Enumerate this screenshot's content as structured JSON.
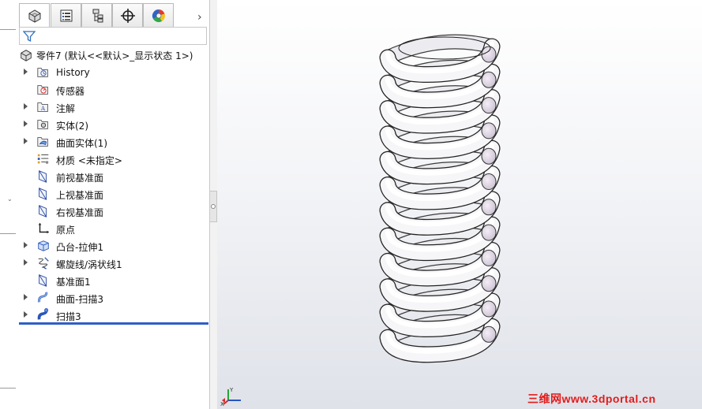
{
  "panel": {
    "tabs": [
      {
        "name": "feature-manager-tab",
        "icon": "part-tree-icon"
      },
      {
        "name": "property-manager-tab",
        "icon": "property-list-icon"
      },
      {
        "name": "configuration-manager-tab",
        "icon": "configuration-icon"
      },
      {
        "name": "dimxpert-tab",
        "icon": "crosshair-icon"
      },
      {
        "name": "display-manager-tab",
        "icon": "color-wheel-icon"
      }
    ],
    "more_glyph": "›",
    "root_label": "零件7  (默认<<默认>_显示状态 1>)",
    "items": [
      {
        "label": "History",
        "expandable": true,
        "icon": "history-folder-icon"
      },
      {
        "label": "传感器",
        "expandable": false,
        "icon": "sensor-folder-icon"
      },
      {
        "label": "注解",
        "expandable": true,
        "icon": "annotation-folder-icon"
      },
      {
        "label": "实体(2)",
        "expandable": true,
        "icon": "solid-bodies-folder-icon"
      },
      {
        "label": "曲面实体(1)",
        "expandable": true,
        "icon": "surface-bodies-folder-icon"
      },
      {
        "label": "材质 <未指定>",
        "expandable": false,
        "icon": "material-icon"
      },
      {
        "label": "前视基准面",
        "expandable": false,
        "icon": "plane-icon"
      },
      {
        "label": "上视基准面",
        "expandable": false,
        "icon": "plane-icon"
      },
      {
        "label": "右视基准面",
        "expandable": false,
        "icon": "plane-icon"
      },
      {
        "label": "原点",
        "expandable": false,
        "icon": "origin-icon"
      },
      {
        "label": "凸台-拉伸1",
        "expandable": true,
        "icon": "extrude-icon"
      },
      {
        "label": "螺旋线/涡状线1",
        "expandable": true,
        "icon": "helix-icon"
      },
      {
        "label": "基准面1",
        "expandable": false,
        "icon": "plane-icon"
      },
      {
        "label": "曲面-扫描3",
        "expandable": true,
        "icon": "surface-sweep-icon"
      },
      {
        "label": "扫描3",
        "expandable": true,
        "icon": "sweep-icon"
      }
    ]
  },
  "viewport": {
    "model": "spring-model",
    "triad_axes": [
      "Y",
      "X"
    ],
    "watermark": "三维网www.3dportal.cn"
  },
  "colors": {
    "rollback_bar": "#2f5fc8",
    "watermark": "#e31b1b",
    "viewport_top": "#ffffff",
    "viewport_bottom": "#dfe2e9"
  }
}
